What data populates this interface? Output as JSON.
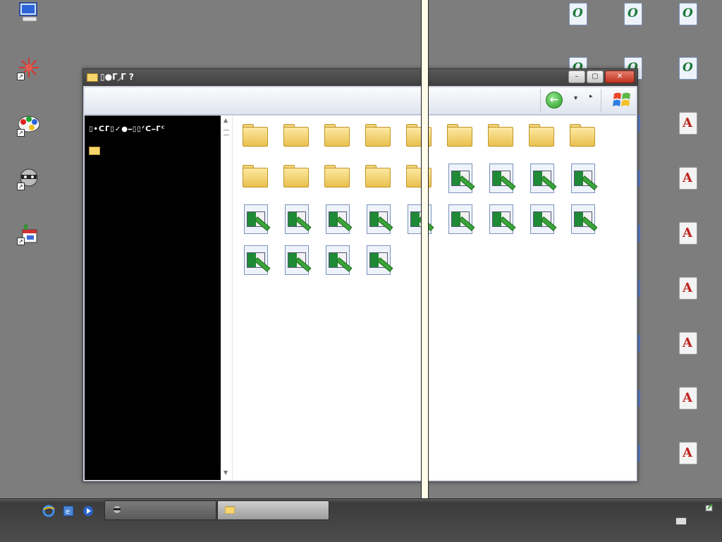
{
  "window": {
    "title": "▯●ᒥ◞ᒥ ?",
    "left_pane_label": "▯•ᑕᒥ▯✓●⎯▯▯ᐟᑕ⎯ᒥᑦ",
    "min_symbol": "–",
    "max_symbol": "▢",
    "close_symbol": "✕"
  },
  "toolbar": {
    "back_symbol": "←",
    "dropdown_symbol": "▾",
    "forward_symbol": "▸"
  },
  "scroll": {
    "up": "▲",
    "down": "▼"
  },
  "colors": {
    "desktop": "#7d7d7d",
    "left_pane": "#000000",
    "divider_bar": "#fffde9",
    "title_bar": "#4a4a4a"
  },
  "icons": {
    "desktop_left": [
      "my-computer-icon",
      "red-burst-shortcut-icon",
      "paint-palette-shortcut-icon",
      "raccoon-shortcut-icon",
      "plant-calendar-shortcut-icon"
    ],
    "content_items": [
      "folder",
      "folder",
      "folder",
      "folder",
      "folder",
      "folder",
      "folder",
      "folder",
      "folder",
      "folder",
      "folder",
      "folder",
      "folder",
      "folder",
      "picture",
      "picture",
      "picture",
      "picture",
      "picture",
      "picture",
      "picture",
      "picture",
      "picture",
      "picture",
      "picture",
      "picture",
      "picture",
      "picture",
      "picture",
      "picture",
      "picture"
    ]
  }
}
